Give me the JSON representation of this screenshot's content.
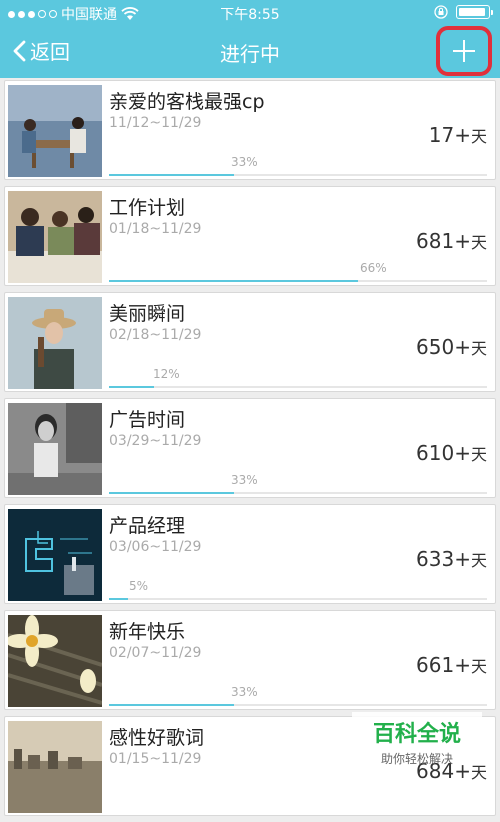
{
  "status": {
    "carrier": "中国联通",
    "time": "下午8:55"
  },
  "nav": {
    "back_label": "返回",
    "title": "进行中"
  },
  "items": [
    {
      "title": "亲爱的客栈最强cp",
      "date": "11/12~11/29",
      "days": "17+",
      "unit": "天",
      "percent_label": "33%",
      "progress": 0.33
    },
    {
      "title": "工作计划",
      "date": "01/18~11/29",
      "days": "681+",
      "unit": "天",
      "percent_label": "66%",
      "progress": 0.66
    },
    {
      "title": "美丽瞬间",
      "date": "02/18~11/29",
      "days": "650+",
      "unit": "天",
      "percent_label": "12%",
      "progress": 0.12
    },
    {
      "title": "广告时间",
      "date": "03/29~11/29",
      "days": "610+",
      "unit": "天",
      "percent_label": "33%",
      "progress": 0.33
    },
    {
      "title": "产品经理",
      "date": "03/06~11/29",
      "days": "633+",
      "unit": "天",
      "percent_label": "5%",
      "progress": 0.05
    },
    {
      "title": "新年快乐",
      "date": "02/07~11/29",
      "days": "661+",
      "unit": "天",
      "percent_label": "33%",
      "progress": 0.33
    },
    {
      "title": "感性好歌词",
      "date": "01/15~11/29",
      "days": "684+",
      "unit": "天",
      "percent_label": "",
      "progress": 0
    }
  ],
  "watermark": {
    "title": "百科全说",
    "subtitle": "助你轻松解决"
  },
  "colors": {
    "accent": "#5bc8de",
    "highlight": "#e0303b",
    "watermark": "#22b04b"
  }
}
